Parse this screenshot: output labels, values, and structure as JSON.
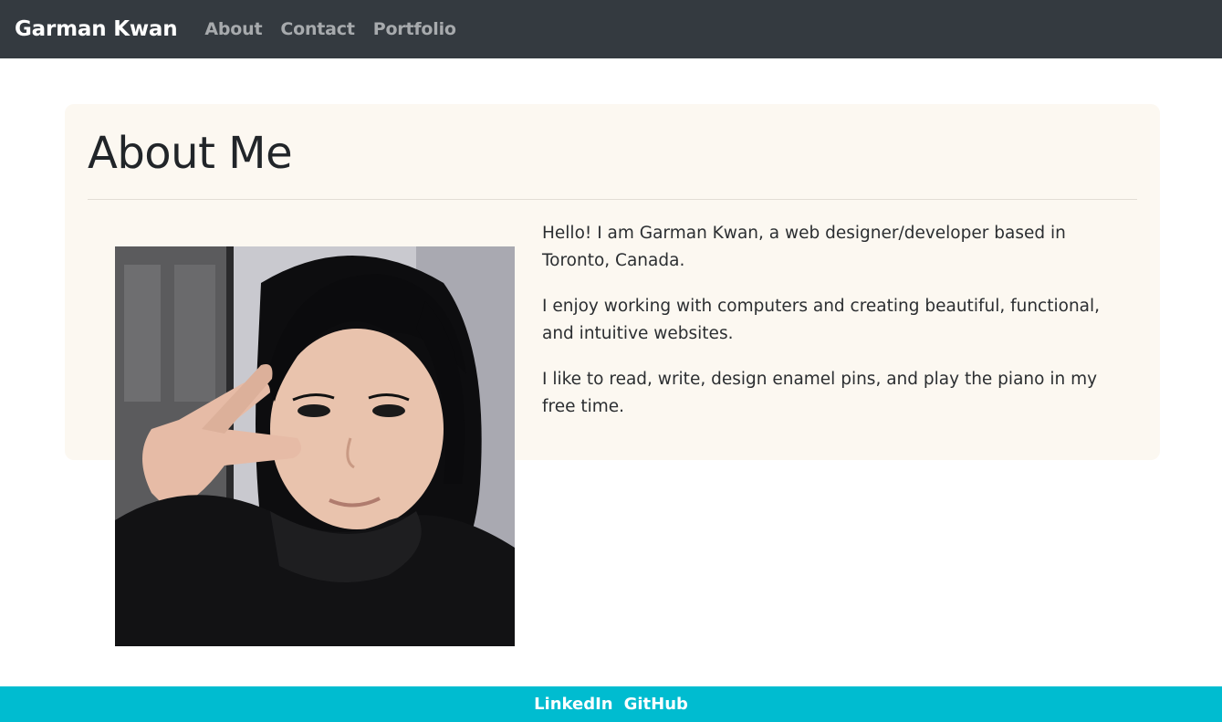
{
  "navbar": {
    "brand": "Garman Kwan",
    "links": [
      {
        "label": "About"
      },
      {
        "label": "Contact"
      },
      {
        "label": "Portfolio"
      }
    ]
  },
  "main": {
    "title": "About Me",
    "paragraphs": [
      "Hello! I am Garman Kwan, a web designer/developer based in Toronto, Canada.",
      "I enjoy working with computers and creating beautiful, functional, and intuitive websites.",
      "I like to read, write, design enamel pins, and play the piano in my free time."
    ],
    "photo": {
      "description_icon": "profile-photo"
    }
  },
  "footer": {
    "links": [
      {
        "label": "LinkedIn"
      },
      {
        "label": "GitHub"
      }
    ]
  },
  "colors": {
    "navbar_bg": "#343a40",
    "card_bg": "#fcf8f1",
    "footer_bg": "#00bcd0",
    "nav_link": "#a7aaad"
  }
}
